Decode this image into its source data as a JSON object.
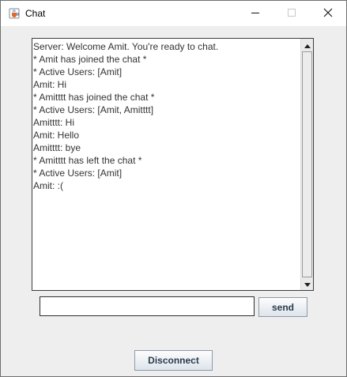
{
  "window": {
    "title": "Chat"
  },
  "titlebar": {
    "app_icon": "java-cup-icon",
    "controls": [
      "minimize-icon",
      "maximize-icon",
      "close-icon"
    ]
  },
  "chat": {
    "messages": [
      "Server: Welcome Amit. You're ready to chat.",
      "* Amit has joined the chat *",
      "* Active Users: [Amit]",
      "Amit: Hi",
      "* Amitttt has joined the chat *",
      "* Active Users: [Amit, Amitttt]",
      "Amitttt: Hi",
      "Amit: Hello",
      "Amitttt: bye",
      "* Amitttt has left the chat *",
      "* Active Users: [Amit]",
      "Amit: :("
    ]
  },
  "composer": {
    "input_value": "",
    "send_label": "send"
  },
  "footer": {
    "disconnect_label": "Disconnect"
  },
  "colors": {
    "window_bg": "#eeeeee",
    "titlebar_bg": "#ffffff",
    "chat_bg": "#ffffff",
    "button_text": "#2b3a4a"
  }
}
